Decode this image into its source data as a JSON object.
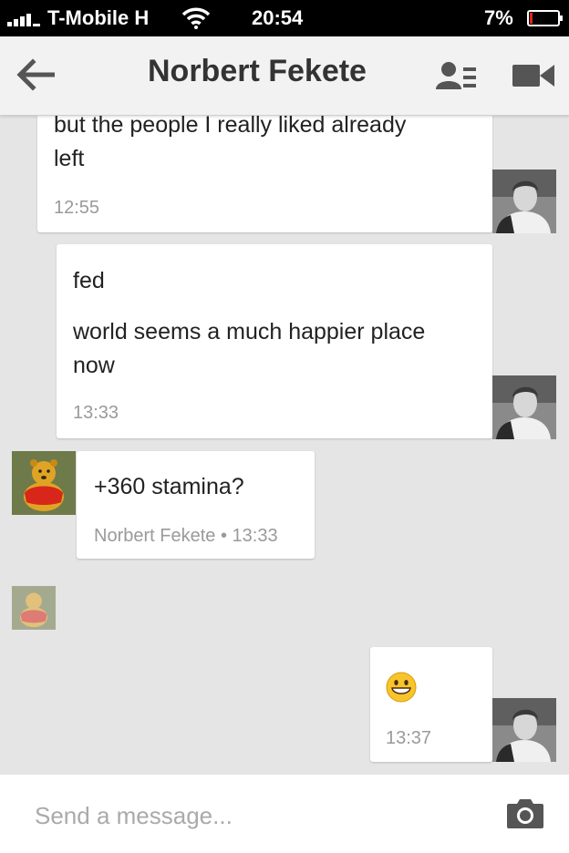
{
  "status_bar": {
    "carrier": "T-Mobile H",
    "time": "20:54",
    "battery": "7%"
  },
  "header": {
    "title": "Norbert Fekete",
    "back_icon": "arrow-left-icon",
    "people_icon": "people-list-icon",
    "video_icon": "video-camera-icon"
  },
  "messages": [
    {
      "lines": [
        "but the people I really liked already",
        "left"
      ],
      "time": "12:55",
      "direction": "outgoing"
    },
    {
      "lines": [
        "fed",
        "world seems a much happier place",
        "now"
      ],
      "time": "13:33",
      "direction": "outgoing"
    },
    {
      "lines": [
        "+360 stamina?"
      ],
      "sender": "Norbert Fekete",
      "sep": "•",
      "time": "13:33",
      "direction": "incoming"
    },
    {
      "emoji": "grinning-face-icon",
      "time": "13:37",
      "direction": "outgoing"
    }
  ],
  "composer": {
    "placeholder": "Send a message...",
    "camera_icon": "camera-icon"
  },
  "colors": {
    "background": "#e5e5e5",
    "header": "#f2f2f2",
    "bubble": "#ffffff",
    "timestamp": "#9a9a9a",
    "battery_low": "#e0241c"
  }
}
